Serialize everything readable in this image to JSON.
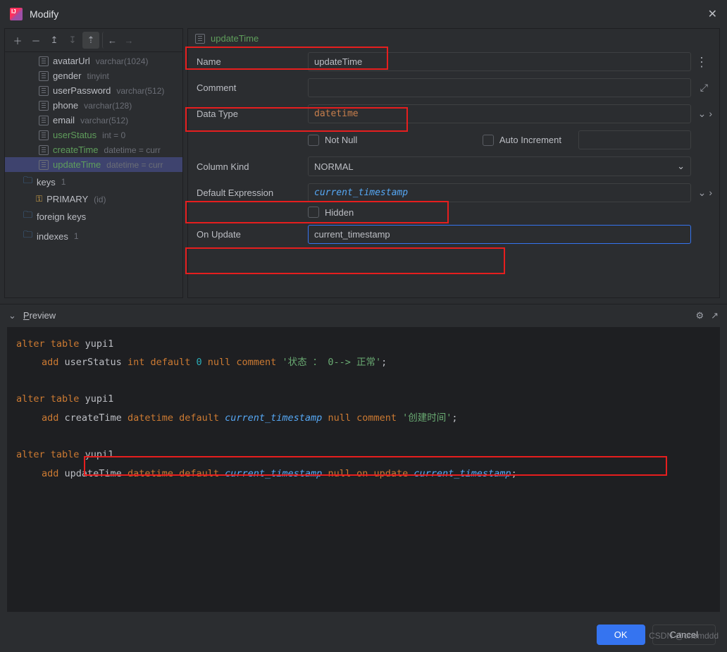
{
  "title": "Modify",
  "breadcrumb": "updateTime",
  "tree": {
    "columns": [
      {
        "name": "avatarUrl",
        "type": "varchar(1024)",
        "green": false
      },
      {
        "name": "gender",
        "type": "tinyint",
        "green": false
      },
      {
        "name": "userPassword",
        "type": "varchar(512)",
        "green": false
      },
      {
        "name": "phone",
        "type": "varchar(128)",
        "green": false
      },
      {
        "name": "email",
        "type": "varchar(512)",
        "green": false
      },
      {
        "name": "userStatus",
        "type": "int = 0",
        "green": true
      },
      {
        "name": "createTime",
        "type": "datetime = curr",
        "green": true
      },
      {
        "name": "updateTime",
        "type": "datetime = curr",
        "green": true,
        "sel": true
      }
    ],
    "keys_label": "keys",
    "keys_count": "1",
    "primary_label": "PRIMARY",
    "primary_id": "(id)",
    "foreign_label": "foreign keys",
    "indexes_label": "indexes",
    "indexes_count": "1"
  },
  "form": {
    "name_lbl": "Name",
    "name_val": "updateTime",
    "comment_lbl": "Comment",
    "comment_val": "",
    "datatype_lbl": "Data Type",
    "datatype_val": "datetime",
    "notnull_lbl": "Not Null",
    "autoinc_lbl": "Auto Increment",
    "autoinc_val": "",
    "kind_lbl": "Column Kind",
    "kind_val": "NORMAL",
    "default_lbl": "Default Expression",
    "default_val": "current_timestamp",
    "hidden_lbl": "Hidden",
    "onupdate_lbl": "On Update",
    "onupdate_val": "current_timestamp"
  },
  "preview_lbl": "review",
  "sql": {
    "l1": "alter table yupi1",
    "l2_add": "add",
    "l2_col": "userStatus",
    "l2_type": "int default",
    "l2_num": "0",
    "l2_null": "null comment",
    "l2_str": "'状态 ： 0--> 正常'",
    "l3": "alter table yupi1",
    "l4_add": "add",
    "l4_col": "createTime",
    "l4_type": "datetime default",
    "l4_fn": "current_timestamp",
    "l4_null": "null comment",
    "l4_str": "'创建时间'",
    "l5": "alter table yupi1",
    "l6_add": "add",
    "l6_col": "updateTime",
    "l6_type": "datetime default",
    "l6_fn": "current_timestamp",
    "l6_null": "null on update",
    "l6_fn2": "current_timestamp"
  },
  "ok": "OK",
  "cancel": "Cancel",
  "watermark": "CSDN @chemddd"
}
